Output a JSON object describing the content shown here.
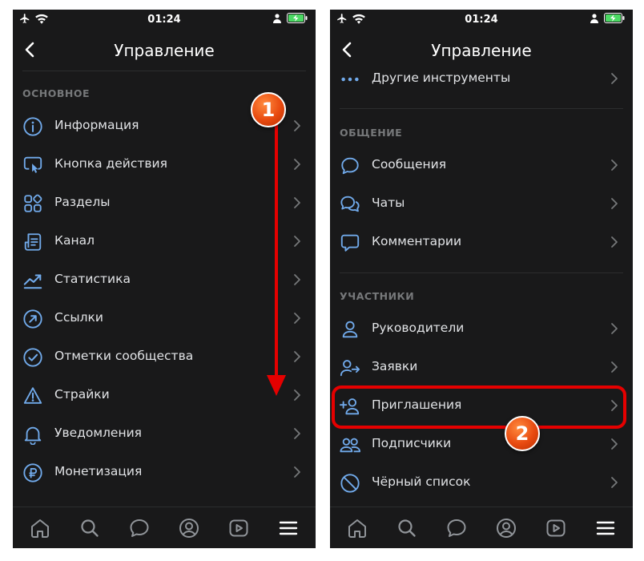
{
  "status": {
    "time": "01:24"
  },
  "left": {
    "title": "Управление",
    "section": "ОСНОВНОЕ",
    "items": [
      {
        "label": "Информация",
        "icon": "info-icon"
      },
      {
        "label": "Кнопка действия",
        "icon": "action-button-icon"
      },
      {
        "label": "Разделы",
        "icon": "sections-icon"
      },
      {
        "label": "Канал",
        "icon": "channel-icon"
      },
      {
        "label": "Статистика",
        "icon": "statistics-icon"
      },
      {
        "label": "Ссылки",
        "icon": "links-icon"
      },
      {
        "label": "Отметки сообщества",
        "icon": "check-circle-icon"
      },
      {
        "label": "Страйки",
        "icon": "warning-icon"
      },
      {
        "label": "Уведомления",
        "icon": "bell-icon"
      },
      {
        "label": "Монетизация",
        "icon": "ruble-icon"
      }
    ]
  },
  "right": {
    "title": "Управление",
    "top_item": {
      "label": "Другие инструменты",
      "icon": "more-dots-icon"
    },
    "section_communication": "ОБЩЕНИЕ",
    "communication": [
      {
        "label": "Сообщения",
        "icon": "message-icon"
      },
      {
        "label": "Чаты",
        "icon": "chats-icon"
      },
      {
        "label": "Комментарии",
        "icon": "comment-icon"
      }
    ],
    "section_members": "УЧАСТНИКИ",
    "members": [
      {
        "label": "Руководители",
        "icon": "user-icon"
      },
      {
        "label": "Заявки",
        "icon": "user-request-icon"
      },
      {
        "label": "Приглашения",
        "icon": "user-add-icon"
      },
      {
        "label": "Подписчики",
        "icon": "users-icon"
      },
      {
        "label": "Чёрный список",
        "icon": "block-icon"
      }
    ]
  },
  "annotations": {
    "step1": "1",
    "step2": "2"
  },
  "colors": {
    "accent": "#71aaeb",
    "background": "#19191a",
    "annotation": "#e50000"
  }
}
